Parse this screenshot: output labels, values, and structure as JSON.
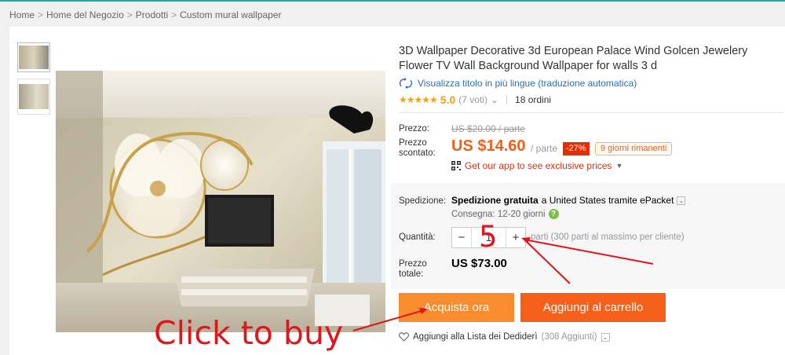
{
  "breadcrumb": [
    "Home",
    "Home del Negozio",
    "Prodotti",
    "Custom mural wallpaper"
  ],
  "breadcrumb_separator": ">",
  "product": {
    "title": "3D Wallpaper Decorative 3d European Palace Wind Golcen Jewelery Flower TV Wall Background Wallpaper for walls 3 d",
    "translate_link": "Visualizza titolo in più lingue (traduzione automatica)",
    "stars": "★★★★★",
    "rating_score": "5.0",
    "rating_votes": "(7 voti)",
    "orders": "18 ordini"
  },
  "pricing": {
    "price_label": "Prezzo:",
    "old_price": "US $20.00 / parte",
    "discount_label": "Prezzo scontato:",
    "new_price": "US $14.60",
    "per_unit": "/ parte",
    "discount": "-27%",
    "days_left": "9 giorni rimanenti",
    "app_text": "Get our app to see exclusive prices"
  },
  "shipping": {
    "label": "Spedizione:",
    "free_text": "Spedizione gratuita",
    "destination": "a United States tramite ePacket",
    "delivery": "Consegna: 12-20 giorni"
  },
  "quantity": {
    "label": "Quantità:",
    "minus": "−",
    "value": "1",
    "plus": "+",
    "hint": "parti (300 parti al massimo per cliente)"
  },
  "total": {
    "label": "Prezzo totale:",
    "value": "US $73.00"
  },
  "actions": {
    "buy_now": "Acquista ora",
    "add_to_cart": "Aggiungi al carrello",
    "wishlist": "Aggiungi alla Lista dei Dediderì",
    "wishlist_count": "(308 Aggiunti)"
  },
  "annotations": {
    "click_to_buy": "Click to buy",
    "quantity_number": "5"
  },
  "colors": {
    "accent_orange": "#f35f14",
    "buy_button": "#f98c2e",
    "cart_button": "#f5601b",
    "annotation_red": "#e0161b",
    "link_blue": "#2a6eb8"
  }
}
